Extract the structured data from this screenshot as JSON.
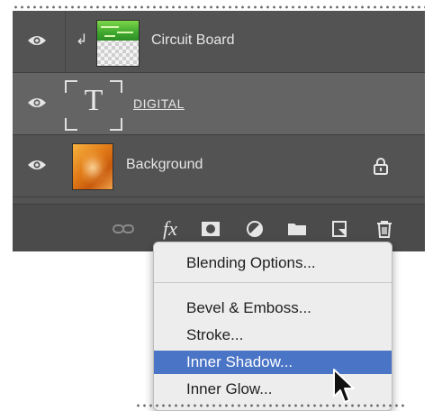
{
  "layers_panel": {
    "layers": [
      {
        "name": "Circuit Board",
        "clipped": true
      },
      {
        "name": "DIGITAL",
        "type": "text",
        "selected": true
      },
      {
        "name": "Background",
        "locked": true
      }
    ],
    "text_thumb_glyph": "T",
    "clip_arrow": "↲",
    "fx_label": "fx"
  },
  "toolbar_icons": [
    "link-icon",
    "fx-icon",
    "mask-icon",
    "adjustment-icon",
    "folder-icon",
    "new-layer-icon",
    "trash-icon"
  ],
  "context_menu": {
    "items": [
      {
        "label": "Blending Options..."
      },
      {
        "label": "Bevel & Emboss..."
      },
      {
        "label": "Stroke..."
      },
      {
        "label": "Inner Shadow...",
        "highlighted": true
      },
      {
        "label": "Inner Glow..."
      }
    ]
  },
  "colors": {
    "panel_bg": "#535353",
    "selected_layer_bg": "#646464",
    "menu_highlight": "#4a74c6",
    "menu_bg": "#ededed"
  }
}
